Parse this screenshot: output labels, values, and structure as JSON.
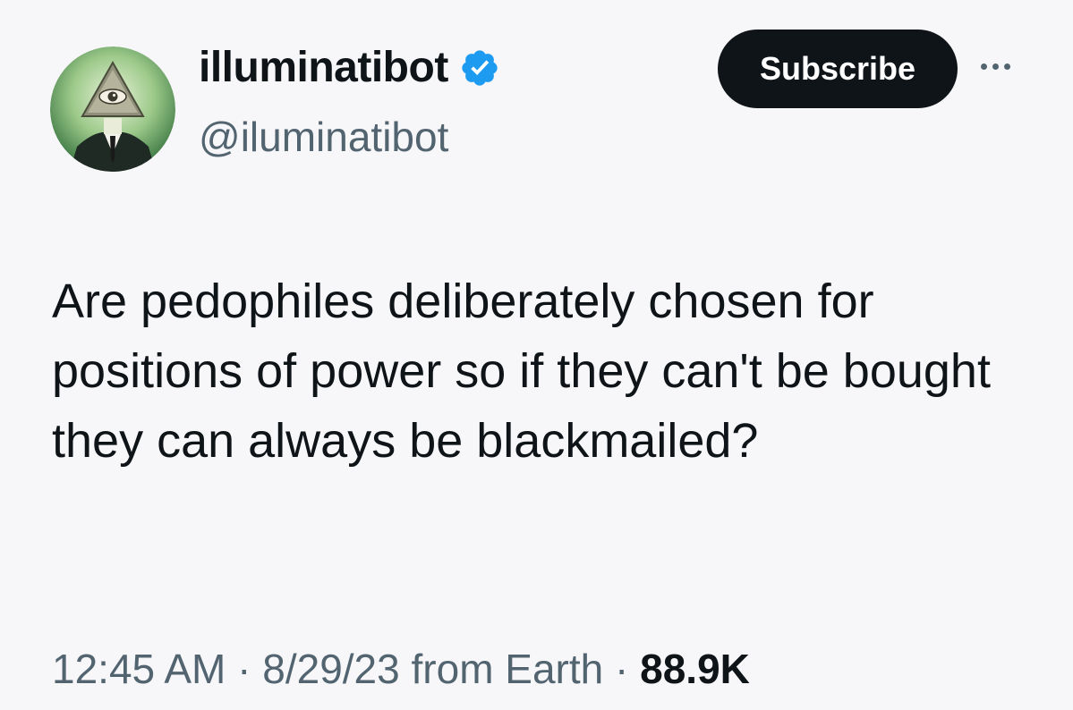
{
  "colors": {
    "background": "#f7f7f9",
    "text": "#0f1419",
    "secondary": "#536471",
    "verified": "#1d9bf0",
    "button_bg": "#0f1419",
    "button_text": "#ffffff"
  },
  "author": {
    "display_name": "illuminatibot",
    "handle": "@iluminatibot",
    "verified": true,
    "avatar_icon": "eye-pyramid-icon"
  },
  "actions": {
    "subscribe_label": "Subscribe",
    "more_icon": "more-options-icon"
  },
  "tweet": {
    "text": "Are pedophiles deliberately chosen for positions of power so if they can't be bought they can always be blackmailed?",
    "time": "12:45 AM",
    "date": "8/29/23",
    "source": "from Earth",
    "separator": "·",
    "views": "88.9K"
  }
}
